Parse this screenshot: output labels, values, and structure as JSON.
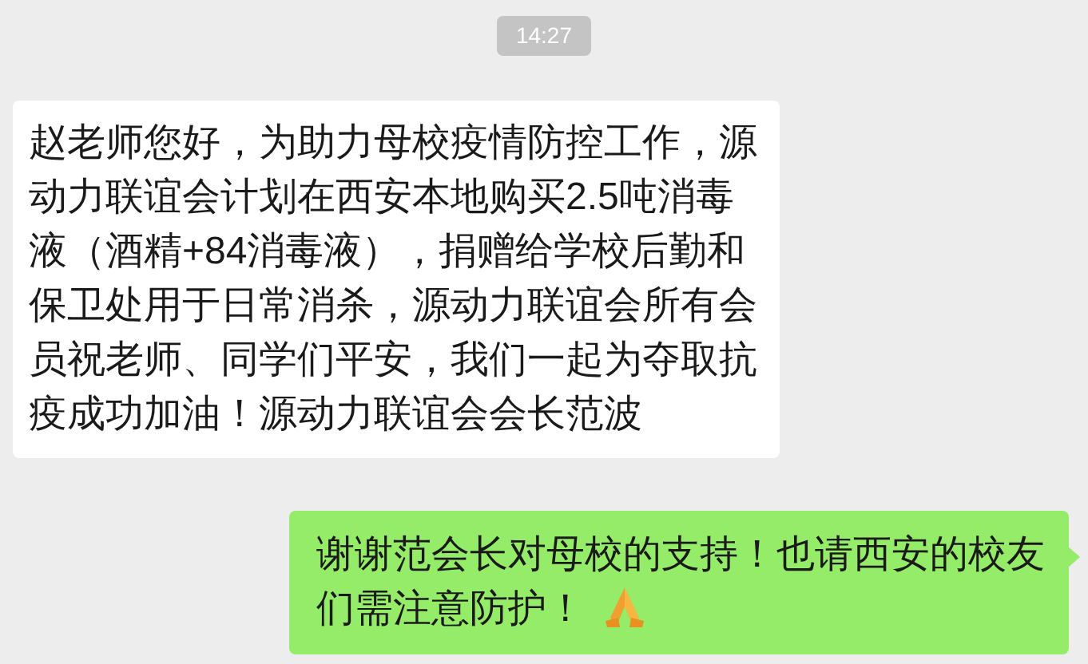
{
  "timestamp": "14:27",
  "messages": [
    {
      "kind": "received",
      "text": "赵老师您好，为助力母校疫情防控工作，源动力联谊会计划在西安本地购买2.5吨消毒液（酒精+84消毒液），捐赠给学校后勤和保卫处用于日常消杀，源动力联谊会所有会员祝老师、同学们平安，我们一起为夺取抗疫成功加油！源动力联谊会会长范波",
      "trailing_emoji": false
    },
    {
      "kind": "sent",
      "text": "谢谢范会长对母校的支持！也请西安的校友们需注意防护！",
      "trailing_emoji": true
    }
  ]
}
